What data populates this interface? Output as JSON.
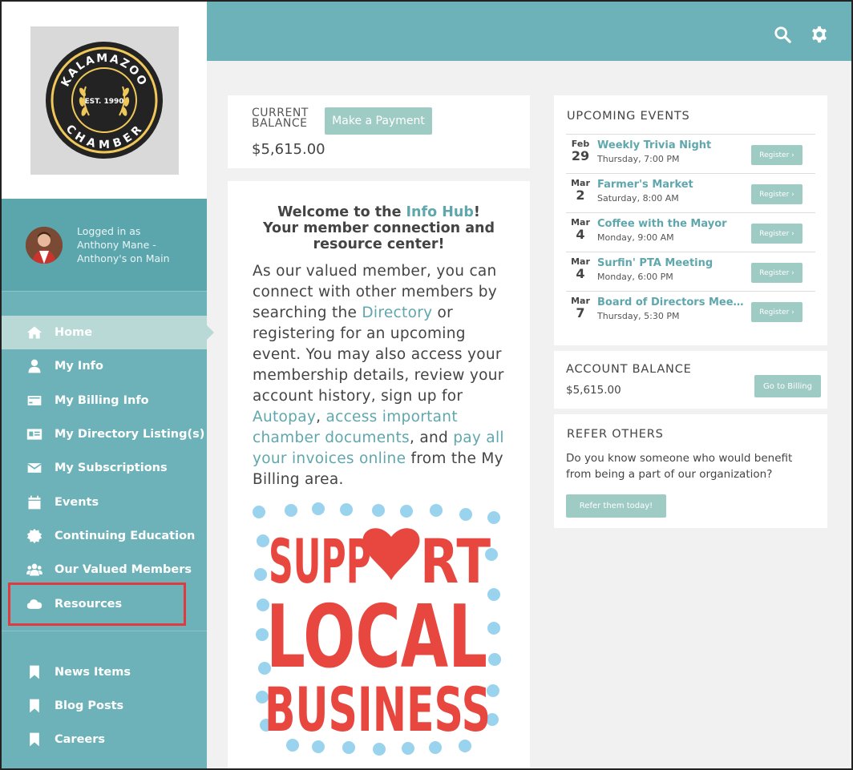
{
  "sidebar": {
    "logo": {
      "top": "KALAMAZOO",
      "mid": "EST. 1990",
      "bottom": "CHAMBER"
    },
    "user": {
      "line1": "Logged in as",
      "line2": "Anthony Mane -",
      "line3": "Anthony's on Main"
    },
    "items": [
      {
        "label": "Home",
        "icon": "home-icon"
      },
      {
        "label": "My Info",
        "icon": "user-icon"
      },
      {
        "label": "My Billing Info",
        "icon": "credit-card-icon"
      },
      {
        "label": "My Directory Listing(s)",
        "icon": "id-card-icon"
      },
      {
        "label": "My Subscriptions",
        "icon": "envelope-icon"
      },
      {
        "label": "Events",
        "icon": "calendar-icon"
      },
      {
        "label": "Continuing Education",
        "icon": "certificate-icon"
      },
      {
        "label": "Our Valued Members",
        "icon": "users-icon"
      },
      {
        "label": "Resources",
        "icon": "cloud-icon"
      }
    ],
    "items2": [
      {
        "label": "News Items",
        "icon": "bookmark-icon"
      },
      {
        "label": "Blog Posts",
        "icon": "bookmark-icon"
      },
      {
        "label": "Careers",
        "icon": "bookmark-icon"
      }
    ]
  },
  "balance": {
    "label1": "CURRENT",
    "label2": "BALANCE",
    "amount": "$5,615.00",
    "button": "Make a Payment"
  },
  "welcome": {
    "h1a": "Welcome to the ",
    "h1link": "Info Hub",
    "h1b": "!",
    "h2": "Your member connection and resource center!",
    "p1": "As our valued member, you can connect with other members by searching the ",
    "directory": "Directory",
    "p2": " or registering for an upcoming event. You may also access your membership details, review your account history, sign up for ",
    "autopay": "Autopay",
    "p3": ", ",
    "docs": "access important chamber documents",
    "p4": ", and ",
    "invoices": "pay all your invoices online",
    "p5": " from the My Billing area.",
    "poster": {
      "line1a": "SUPP",
      "line1b": "RT",
      "line2": "LOCAL",
      "line3": "BUSINESS"
    }
  },
  "events": {
    "title": "UPCOMING EVENTS",
    "register": "Register ›",
    "items": [
      {
        "mon": "Feb",
        "day": "29",
        "title": "Weekly Trivia Night",
        "time": "Thursday, 7:00 PM"
      },
      {
        "mon": "Mar",
        "day": "2",
        "title": "Farmer's Market",
        "time": "Saturday, 8:00 AM"
      },
      {
        "mon": "Mar",
        "day": "4",
        "title": "Coffee with the Mayor",
        "time": "Monday, 9:00 AM"
      },
      {
        "mon": "Mar",
        "day": "4",
        "title": "Surfin' PTA Meeting",
        "time": "Monday, 6:00 PM"
      },
      {
        "mon": "Mar",
        "day": "7",
        "title": "Board of Directors Meeti...",
        "time": "Thursday, 5:30 PM"
      }
    ]
  },
  "account": {
    "title": "ACCOUNT BALANCE",
    "amount": "$5,615.00",
    "button": "Go to Billing"
  },
  "refer": {
    "title": "REFER OTHERS",
    "text": "Do you know someone who would benefit from being a part of our organization?",
    "button": "Refer them today!"
  },
  "colors": {
    "teal": "#6db2b8",
    "link": "#5fa7ad",
    "poster_red": "#e8473f",
    "poster_dots": "#9ad3ee"
  }
}
